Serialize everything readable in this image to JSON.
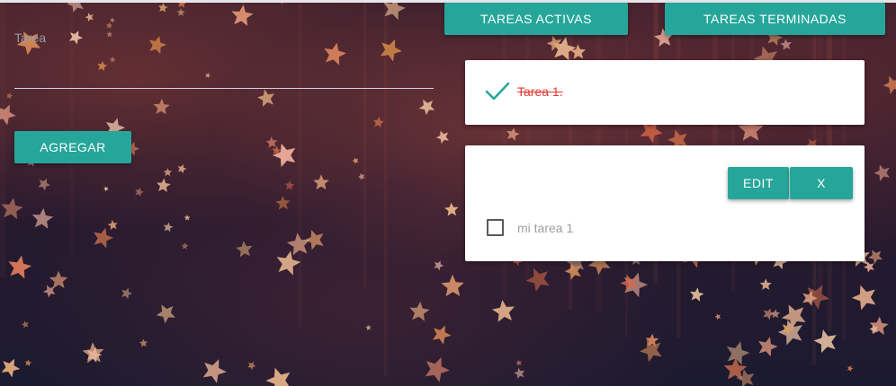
{
  "form": {
    "label": "Tarea",
    "input_value": "",
    "add_button": "AGREGAR"
  },
  "tabs": {
    "active": "TAREAS ACTIVAS",
    "finished": "TAREAS TERMINADAS"
  },
  "finished_tasks": [
    {
      "text": "Tarea 1.",
      "icon": "check-icon"
    }
  ],
  "active_tasks": [
    {
      "text": "mi tarea 1",
      "edit_button": "EDIT",
      "delete_button": "X",
      "checked": false
    }
  ],
  "colors": {
    "accent": "#26a69a",
    "finished_text": "#e53935",
    "muted_text": "#9e9e9e"
  }
}
